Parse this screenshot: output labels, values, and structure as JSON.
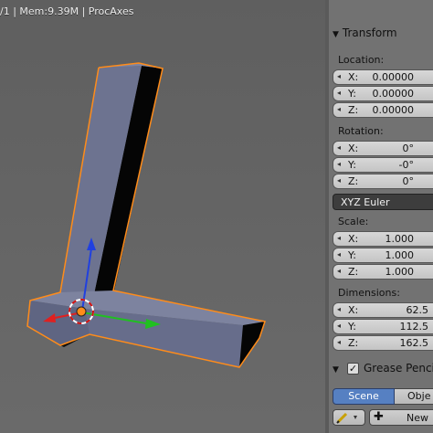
{
  "viewport": {
    "info_text": "/1 | Mem:9.39M | ProcAxes"
  },
  "panel": {
    "transform": {
      "header": "Transform",
      "location": {
        "label": "Location:",
        "x": {
          "axis": "X:",
          "value": "0.00000"
        },
        "y": {
          "axis": "Y:",
          "value": "0.00000"
        },
        "z": {
          "axis": "Z:",
          "value": "0.00000"
        }
      },
      "rotation": {
        "label": "Rotation:",
        "x": {
          "axis": "X:",
          "value": "0°"
        },
        "y": {
          "axis": "Y:",
          "value": "-0°"
        },
        "z": {
          "axis": "Z:",
          "value": "0°"
        }
      },
      "rotation_mode": "XYZ Euler",
      "scale": {
        "label": "Scale:",
        "x": {
          "axis": "X:",
          "value": "1.000"
        },
        "y": {
          "axis": "Y:",
          "value": "1.000"
        },
        "z": {
          "axis": "Z:",
          "value": "1.000"
        }
      },
      "dimensions": {
        "label": "Dimensions:",
        "x": {
          "axis": "X:",
          "value": "62.5"
        },
        "y": {
          "axis": "Y:",
          "value": "112.5"
        },
        "z": {
          "axis": "Z:",
          "value": "162.5"
        }
      }
    },
    "grease_pencil": {
      "header": "Grease Pencil",
      "checked": true,
      "tab_scene": "Scene",
      "tab_object": "Obje",
      "new_label": "New"
    }
  },
  "colors": {
    "selection_outline": "#ff8c1a",
    "object_face": "#6d7390",
    "axis_x": "#e02020",
    "axis_y": "#20c020",
    "axis_z": "#2040e0",
    "active_tab": "#5680c2"
  },
  "icons": [
    "triangle-down-icon",
    "checkbox-icon",
    "pencil-icon",
    "plus-icon",
    "arrows-icon"
  ]
}
